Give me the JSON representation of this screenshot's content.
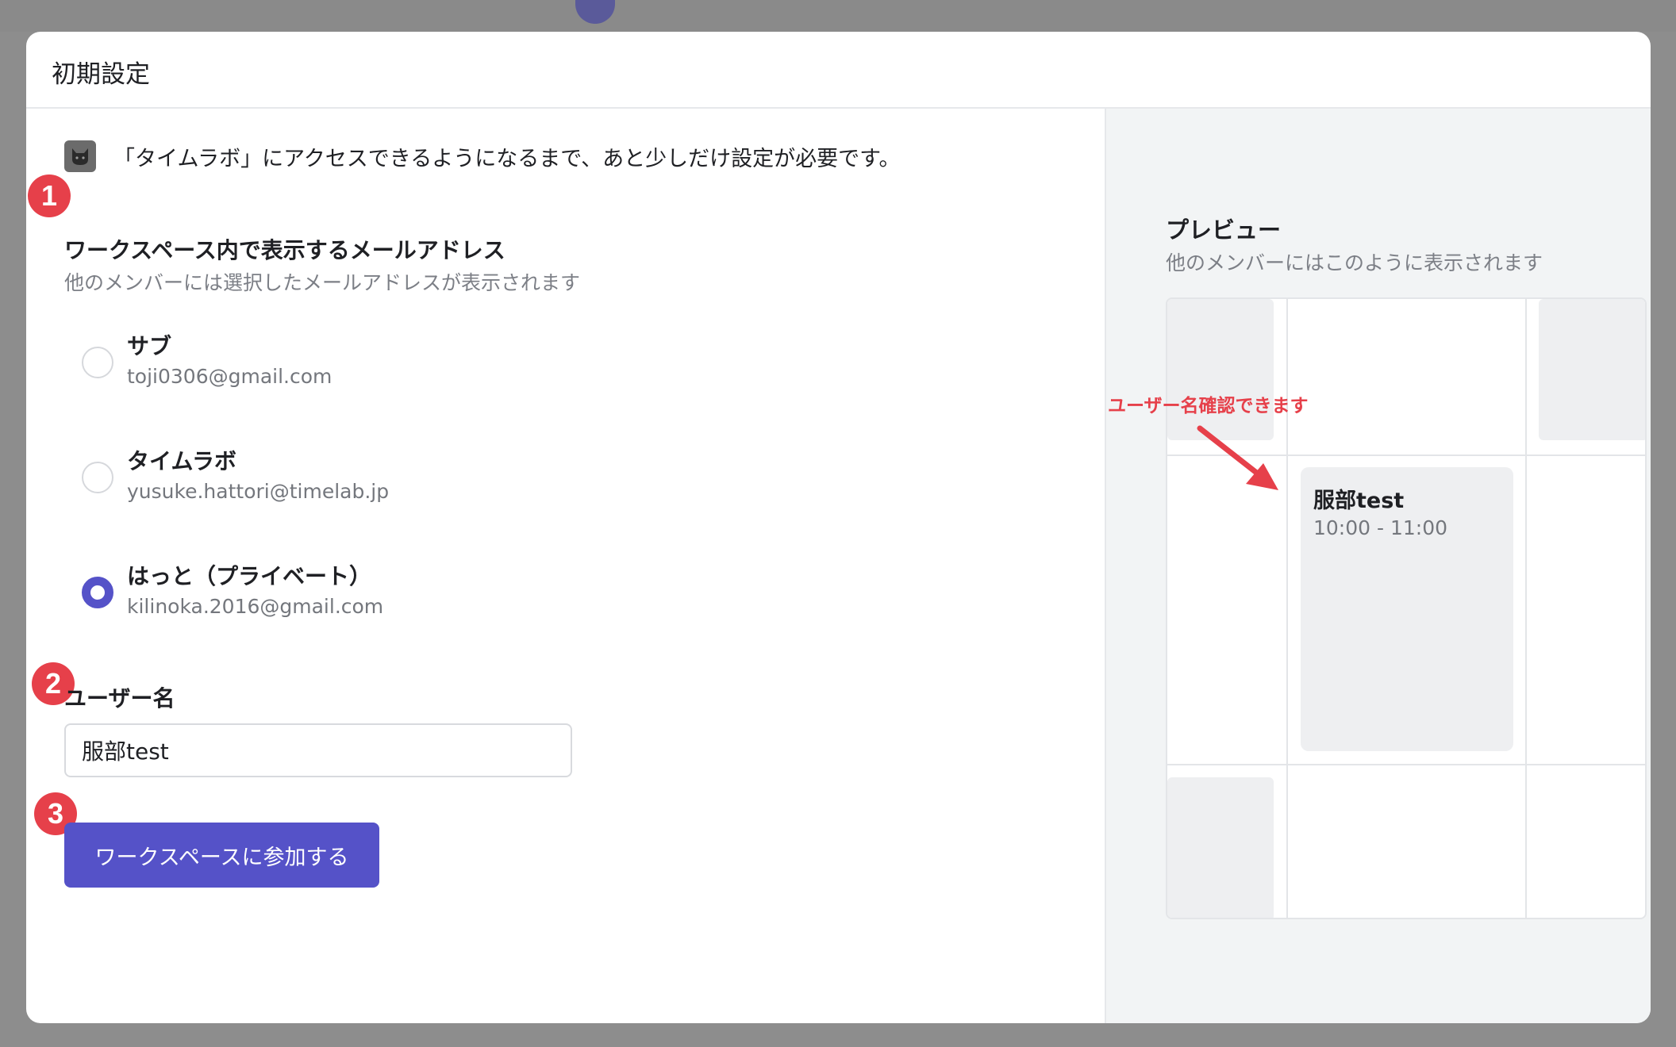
{
  "modal": {
    "title": "初期設定",
    "notice": "「タイムラボ」にアクセスできるようになるまで、あと少しだけ設定が必要です。"
  },
  "steps": [
    "1",
    "2",
    "3"
  ],
  "email_section": {
    "title": "ワークスペース内で表示するメールアドレス",
    "subtitle": "他のメンバーには選択したメールアドレスが表示されます",
    "options": [
      {
        "label": "サブ",
        "email": "toji0306@gmail.com",
        "selected": false
      },
      {
        "label": "タイムラボ",
        "email": "yusuke.hattori@timelab.jp",
        "selected": false
      },
      {
        "label": "はっと（プライベート）",
        "email": "kilinoka.2016@gmail.com",
        "selected": true
      }
    ]
  },
  "username_section": {
    "title": "ユーザー名",
    "value": "服部test"
  },
  "join_button": "ワークスペースに参加する",
  "preview": {
    "title": "プレビュー",
    "subtitle": "他のメンバーにはこのように表示されます",
    "event": {
      "name": "服部test",
      "time": "10:00 - 11:00"
    }
  },
  "annotation": "ユーザー名確認できます",
  "colors": {
    "accent": "#5552c8",
    "badge": "#e6404a"
  },
  "icons": {
    "logo": "cat-logo-icon",
    "arrow": "red-arrow-icon"
  }
}
